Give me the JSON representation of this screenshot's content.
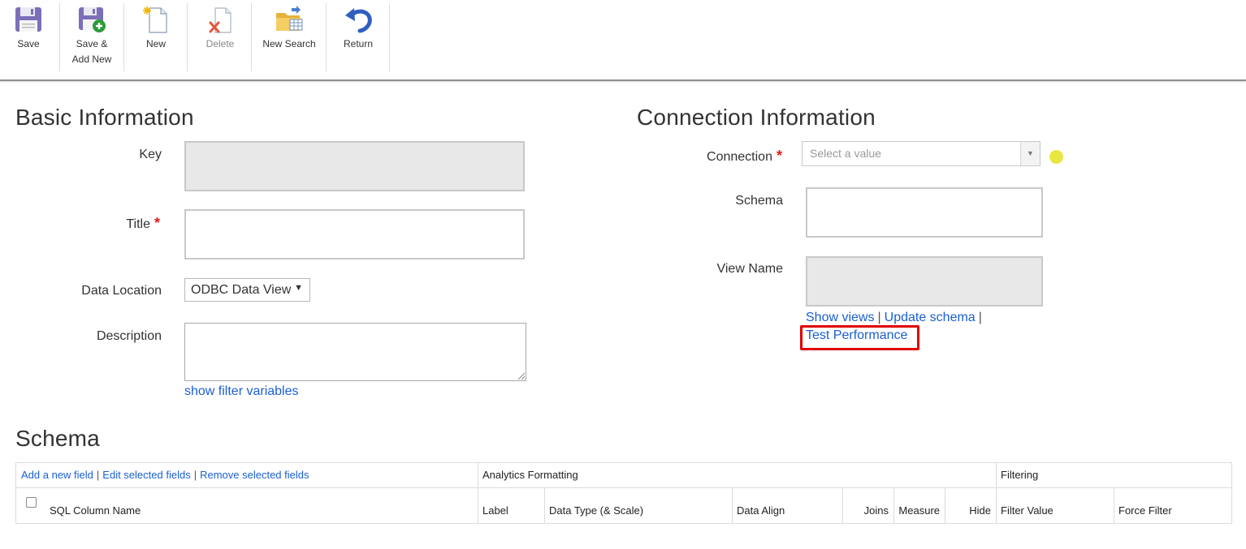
{
  "toolbar": {
    "save": "Save",
    "save_add_new_line1": "Save &",
    "save_add_new_line2": "Add New",
    "new": "New",
    "delete": "Delete",
    "new_search": "New Search",
    "return": "Return"
  },
  "basic_info": {
    "heading": "Basic Information",
    "key_label": "Key",
    "title_label": "Title",
    "required_mark": "*",
    "data_location_label": "Data Location",
    "data_location_value": "ODBC Data View",
    "description_label": "Description",
    "show_filter_variables": "show filter variables"
  },
  "connection_info": {
    "heading": "Connection Information",
    "connection_label": "Connection",
    "connection_placeholder": "Select a value",
    "schema_label": "Schema",
    "view_name_label": "View Name",
    "show_views": "Show views",
    "update_schema": "Update schema",
    "separator": "|",
    "test_performance": "Test Performance"
  },
  "schema_section": {
    "heading": "Schema",
    "add_new_field": "Add a new field",
    "edit_selected_fields": "Edit selected fields",
    "remove_selected_fields": "Remove selected fields",
    "group_analytics_formatting": "Analytics Formatting",
    "group_filtering": "Filtering",
    "columns": {
      "sql_column_name": "SQL Column Name",
      "label": "Label",
      "data_type": "Data Type (& Scale)",
      "data_align": "Data Align",
      "joins": "Joins",
      "measure": "Measure",
      "hide": "Hide",
      "filter_value": "Filter Value",
      "force_filter": "Force Filter"
    }
  },
  "colors": {
    "link": "#1a5fd1",
    "required": "#e21b1b",
    "highlight_border": "#e00000",
    "cursor_dot": "#e8e640"
  }
}
